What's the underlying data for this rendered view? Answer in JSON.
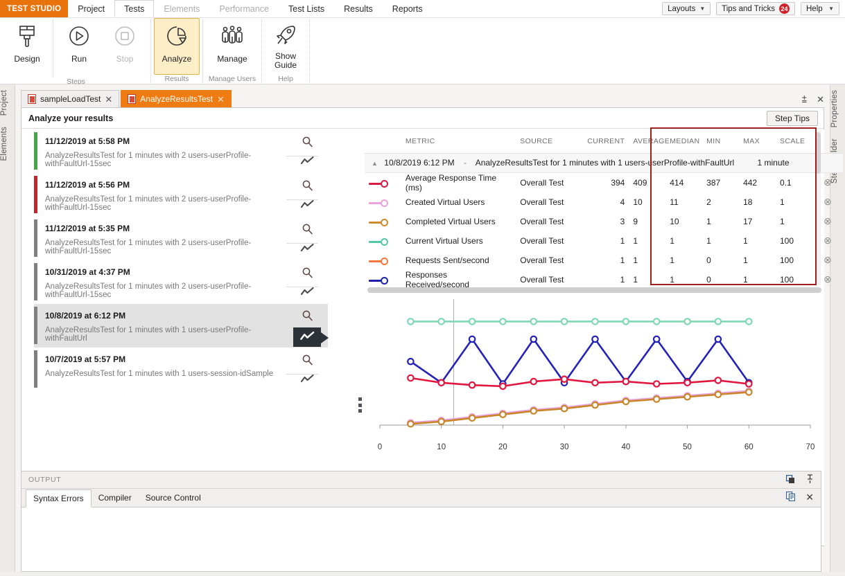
{
  "app": {
    "brand": "TEST STUDIO"
  },
  "menu": {
    "tabs": [
      {
        "label": "Project",
        "state": "normal"
      },
      {
        "label": "Tests",
        "state": "active"
      },
      {
        "label": "Elements",
        "state": "dim"
      },
      {
        "label": "Performance",
        "state": "dim"
      },
      {
        "label": "Test Lists",
        "state": "normal"
      },
      {
        "label": "Results",
        "state": "normal"
      },
      {
        "label": "Reports",
        "state": "normal"
      }
    ],
    "layouts_label": "Layouts",
    "tips_label": "Tips and Tricks",
    "tips_count": "24",
    "help_label": "Help"
  },
  "ribbon": {
    "groups": [
      {
        "name": "Steps",
        "buttons": [
          {
            "label": "Design",
            "icon": "brush-icon",
            "state": "normal"
          },
          {
            "label": "Run",
            "icon": "play-icon",
            "state": "normal"
          },
          {
            "label": "Stop",
            "icon": "stop-icon",
            "state": "disabled"
          }
        ]
      },
      {
        "name": "Results",
        "buttons": [
          {
            "label": "Analyze",
            "icon": "pie-chart-icon",
            "state": "selected"
          }
        ]
      },
      {
        "name": "Manage Users",
        "buttons": [
          {
            "label": "Manage",
            "icon": "users-icon",
            "state": "normal"
          }
        ]
      },
      {
        "name": "Help",
        "buttons": [
          {
            "label": "Show Guide",
            "icon": "rocket-icon",
            "state": "normal"
          }
        ]
      }
    ]
  },
  "dock": {
    "left": [
      "Project",
      "Elements"
    ],
    "right": [
      "Properties",
      "Step Builder"
    ]
  },
  "doctabs": [
    {
      "label": "sampleLoadTest",
      "active": false
    },
    {
      "label": "AnalyzeResultsTest",
      "active": true
    }
  ],
  "content": {
    "title": "Analyze your results",
    "step_tips": "Step Tips"
  },
  "results_list": [
    {
      "date": "11/12/2019 at 5:58 PM",
      "desc": "AnalyzeResultsTest for 1 minutes with 2 users-userProfile-withFaultUrl-15sec",
      "status_color": "#46a546",
      "selected": false
    },
    {
      "date": "11/12/2019 at 5:56 PM",
      "desc": "AnalyzeResultsTest for 1 minutes with 2 users-userProfile-withFaultUrl-15sec",
      "status_color": "#c0262b",
      "selected": false
    },
    {
      "date": "11/12/2019 at 5:35 PM",
      "desc": "AnalyzeResultsTest for 1 minutes with 2 users-userProfile-withFaultUrl-15sec",
      "status_color": "#808080",
      "selected": false
    },
    {
      "date": "10/31/2019 at 4:37 PM",
      "desc": "AnalyzeResultsTest for 1 minutes with 2 users-userProfile-withFaultUrl-15sec",
      "status_color": "#808080",
      "selected": false
    },
    {
      "date": "10/8/2019 at 6:12 PM",
      "desc": "AnalyzeResultsTest for 1 minutes with 1 users-userProfile-withFaultUrl",
      "status_color": "#808080",
      "selected": true
    },
    {
      "date": "10/7/2019 at 5:57 PM",
      "desc": "AnalyzeResultsTest for 1 minutes with 1 users-session-idSample",
      "status_color": "#808080",
      "selected": false
    }
  ],
  "grid": {
    "columns": [
      "",
      "METRIC",
      "SOURCE",
      "CURRENT",
      "AVERAGE",
      "MEDIAN",
      "MIN",
      "MAX",
      "SCALE",
      ""
    ],
    "group_row": {
      "timestamp": "10/8/2019 6:12 PM",
      "separator": "-",
      "name": "AnalyzeResultsTest for 1 minutes with 1 users-userProfile-withFaultUrl",
      "duration": "1 minute"
    },
    "highlight_color": "#9f1f1f",
    "rows": [
      {
        "color": "#d81b45",
        "metric": "Average Response Time (ms)",
        "source": "Overall Test",
        "current": "394",
        "average": "409",
        "median": "414",
        "min": "387",
        "max": "442",
        "scale": "0.1"
      },
      {
        "color": "#e9a0dc",
        "metric": "Created Virtual Users",
        "source": "Overall Test",
        "current": "4",
        "average": "10",
        "median": "11",
        "min": "2",
        "max": "18",
        "scale": "1"
      },
      {
        "color": "#cf8a2e",
        "metric": "Completed Virtual Users",
        "source": "Overall Test",
        "current": "3",
        "average": "9",
        "median": "10",
        "min": "1",
        "max": "17",
        "scale": "1"
      },
      {
        "color": "#52c9a4",
        "metric": "Current Virtual Users",
        "source": "Overall Test",
        "current": "1",
        "average": "1",
        "median": "1",
        "min": "1",
        "max": "1",
        "scale": "100"
      },
      {
        "color": "#f4773c",
        "metric": "Requests Sent/second",
        "source": "Overall Test",
        "current": "1",
        "average": "1",
        "median": "1",
        "min": "0",
        "max": "1",
        "scale": "100"
      },
      {
        "color": "#1f1fae",
        "metric": "Responses Received/second",
        "source": "Overall Test",
        "current": "1",
        "average": "1",
        "median": "1",
        "min": "0",
        "max": "1",
        "scale": "100"
      }
    ]
  },
  "chart_data": {
    "type": "line",
    "title": "",
    "xlabel": "",
    "ylabel": "",
    "xlim": [
      0,
      70
    ],
    "ylim": [
      0,
      100
    ],
    "xticks": [
      0,
      10,
      20,
      30,
      40,
      50,
      60,
      70
    ],
    "grid": false,
    "legend": "none",
    "cursor_x": 12,
    "x": [
      5,
      10,
      15,
      20,
      25,
      30,
      35,
      40,
      45,
      50,
      55,
      60
    ],
    "series": [
      {
        "name": "Current Virtual Users",
        "color": "#7ed8b5",
        "values": [
          88,
          88,
          88,
          88,
          88,
          88,
          88,
          88,
          88,
          88,
          88,
          88
        ]
      },
      {
        "name": "Responses Received/second",
        "color": "#2222b8",
        "values": [
          54,
          36,
          73,
          35,
          73,
          36,
          73,
          37,
          73,
          37,
          73,
          36
        ]
      },
      {
        "name": "Average Response Time (ms)",
        "color": "#e2173f",
        "values": [
          40,
          36,
          34,
          33,
          37,
          39,
          36,
          37,
          35,
          36,
          38,
          35
        ]
      },
      {
        "name": "Created Virtual Users",
        "color": "#eaa6e2",
        "values": [
          2,
          4,
          7,
          10,
          13,
          15,
          18,
          21,
          23,
          25,
          27,
          29
        ]
      },
      {
        "name": "Completed Virtual Users",
        "color": "#c98528",
        "values": [
          1,
          3,
          6,
          9,
          12,
          14,
          17,
          20,
          22,
          24,
          26,
          28
        ]
      }
    ]
  },
  "output": {
    "title": "OUTPUT",
    "tabs": [
      {
        "label": "Syntax Errors",
        "active": true
      },
      {
        "label": "Compiler",
        "active": false
      },
      {
        "label": "Source Control",
        "active": false
      }
    ]
  }
}
